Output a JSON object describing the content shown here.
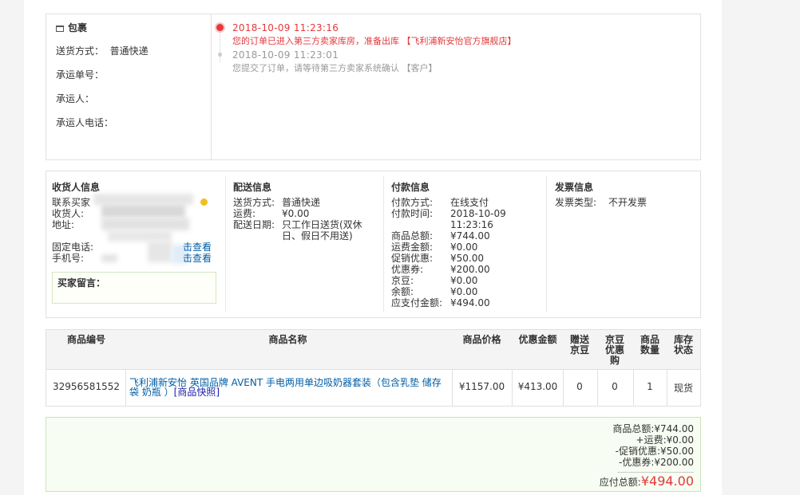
{
  "package": {
    "title": "包裹",
    "ship_method_label": "送货方式：",
    "ship_method_value": "普通快递",
    "tracking_no_label": "承运单号：",
    "carrier_label": "承运人：",
    "carrier_phone_label": "承运人电话：",
    "timeline": [
      {
        "time": "2018-10-09 11:23:16",
        "message": "您的订单已进入第三方卖家库房，准备出库 【飞利浦新安怡官方旗舰店】"
      },
      {
        "time": "2018-10-09 11:23:01",
        "message": "您提交了订单，请等待第三方卖家系统确认 【客户】"
      }
    ]
  },
  "receiver": {
    "title": "收货人信息",
    "contact_label": "联系买家",
    "name_label": "收货人:",
    "address_label": "地址:",
    "phone_label": "固定电话:",
    "mobile_label": "手机号:",
    "view_link": "击查看",
    "message_label": "买家留言："
  },
  "delivery": {
    "title": "配送信息",
    "method_label": "送货方式:",
    "method_value": "普通快递",
    "fee_label": "运费:",
    "fee_value": "¥0.00",
    "date_label": "配送日期:",
    "date_value_line1": "只工作日送货(双休",
    "date_value_line2": "日、假日不用送)"
  },
  "payment": {
    "title": "付款信息",
    "rows": [
      {
        "label": "付款方式:",
        "value": "在线支付"
      },
      {
        "label": "付款时间:",
        "value": "2018-10-09"
      },
      {
        "label": "",
        "value": "11:23:16"
      },
      {
        "label": "商品总额:",
        "value": "¥744.00"
      },
      {
        "label": "运费金额:",
        "value": "¥0.00"
      },
      {
        "label": "促销优惠:",
        "value": "¥50.00"
      },
      {
        "label": "优惠券:",
        "value": "¥200.00"
      },
      {
        "label": "京豆:",
        "value": "¥0.00"
      },
      {
        "label": "余额:",
        "value": "¥0.00"
      },
      {
        "label": "应支付金额:",
        "value": "¥494.00"
      }
    ]
  },
  "invoice": {
    "title": "发票信息",
    "type_label": "发票类型:",
    "type_value": "不开发票"
  },
  "table": {
    "headers": {
      "sku": "商品编号",
      "name": "商品名称",
      "price": "商品价格",
      "discount": "优惠金额",
      "gift_jd_line1": "赠送",
      "gift_jd_line2": "京豆",
      "jd_coupon_line1": "京豆",
      "jd_coupon_line2": "优惠",
      "jd_coupon_line3": "购",
      "qty_line1": "商品",
      "qty_line2": "数量",
      "stock_line1": "库存",
      "stock_line2": "状态"
    },
    "row": {
      "sku": "32956581552",
      "name": "飞利浦新安怡 英国品牌 AVENT 手电两用单边吸奶器套装（包含乳垫 储存袋 奶瓶 ）",
      "snapshot": "[商品快照]",
      "price": "¥1157.00",
      "discount": "¥413.00",
      "gift_jd": "0",
      "jd_coupon": "0",
      "qty": "1",
      "stock": "现货"
    }
  },
  "summary": {
    "lines": [
      "商品总额:¥744.00",
      "+运费:¥0.00",
      "-促销优惠:¥50.00",
      "-优惠券:¥200.00"
    ],
    "total_label": "应付总额:",
    "total_value": "¥494.00"
  },
  "colors": {
    "accent_red": "#e4393c",
    "link_blue": "#005ea7"
  }
}
